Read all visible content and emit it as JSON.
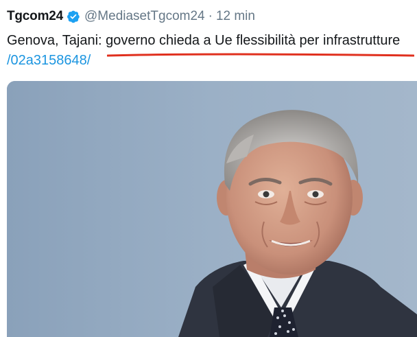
{
  "tweet": {
    "author_name": "Tgcom24",
    "verified_icon": "verified-badge-icon",
    "handle": "@MediasetTgcom24",
    "separator": "·",
    "timestamp": "12 min",
    "text_prefix": "Genova, Tajani: ",
    "text_underlined": "governo chieda a Ue flessibilità per infrastrutture",
    "link_text": "/02a3158648/",
    "annotation_color": "#e0301e",
    "link_color": "#1b95e0",
    "verified_color": "#1da1f2"
  }
}
